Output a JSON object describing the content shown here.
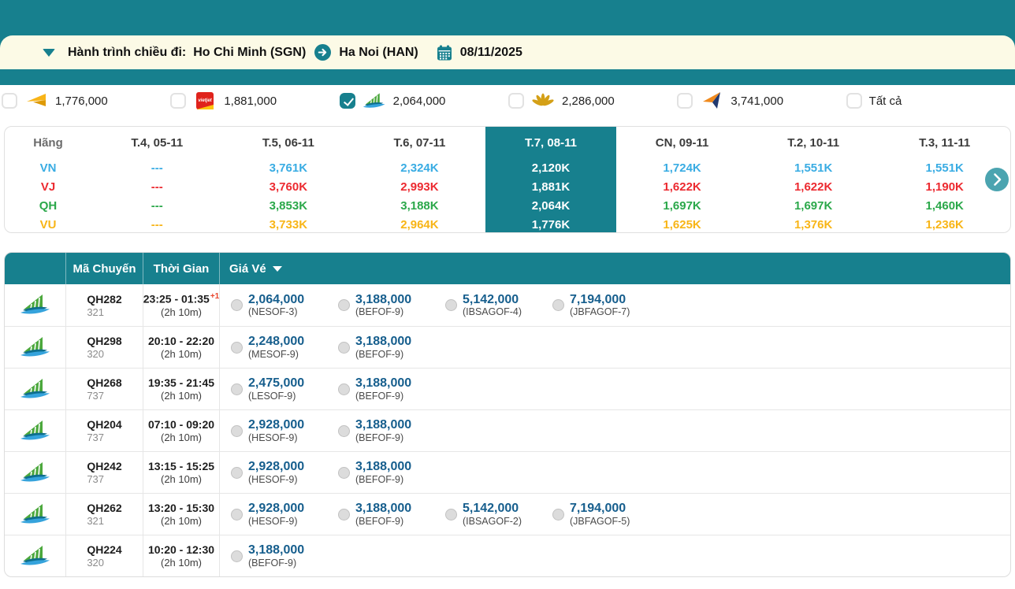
{
  "theme": {
    "teal": "#17808E",
    "teal_light": "#4BA4B0",
    "beige": "#FCFAE6",
    "price_blue": "#165E8D"
  },
  "journey": {
    "label": "Hành trình chiều đi:",
    "origin": "Ho Chi Minh (SGN)",
    "destination": "Ha Noi (HAN)",
    "date": "08/11/2025"
  },
  "filters": {
    "items": [
      {
        "logo": "vietravel-arrow-logo",
        "price": "1,776,000",
        "checked": false
      },
      {
        "logo": "vietjet-logo",
        "price": "1,881,000",
        "checked": false
      },
      {
        "logo": "bamboo-airways-logo",
        "price": "2,064,000",
        "checked": true
      },
      {
        "logo": "vietnam-airlines-lotus-logo",
        "price": "2,286,000",
        "checked": false
      },
      {
        "logo": "paper-plane-logo",
        "price": "3,741,000",
        "checked": false
      },
      {
        "label": "Tất cả",
        "checked": false
      }
    ],
    "vietjet_logo_text": "vietjet"
  },
  "price_matrix": {
    "columns": [
      "Hãng",
      "T.4, 05-11",
      "T.5, 06-11",
      "T.6, 07-11",
      "T.7, 08-11",
      "CN, 09-11",
      "T.2, 10-11",
      "T.3, 11-11"
    ],
    "selected_column_index": 4,
    "rows": [
      {
        "code": "VN",
        "color": "#39ACE3",
        "values": [
          "---",
          "3,761K",
          "2,324K",
          "2,120K",
          "1,724K",
          "1,551K",
          "1,551K"
        ]
      },
      {
        "code": "VJ",
        "color": "#EC2A30",
        "values": [
          "---",
          "3,760K",
          "2,993K",
          "1,881K",
          "1,622K",
          "1,622K",
          "1,190K"
        ]
      },
      {
        "code": "QH",
        "color": "#2BA84A",
        "values": [
          "---",
          "3,853K",
          "3,188K",
          "2,064K",
          "1,697K",
          "1,697K",
          "1,460K"
        ]
      },
      {
        "code": "VU",
        "color": "#F8B517",
        "values": [
          "---",
          "3,733K",
          "2,964K",
          "1,776K",
          "1,625K",
          "1,376K",
          "1,236K"
        ]
      }
    ]
  },
  "flight_table": {
    "headers": {
      "flight_code": "Mã Chuyến",
      "time": "Thời Gian",
      "price": "Giá Vé"
    },
    "rows": [
      {
        "flight": "QH282",
        "aircraft": "321",
        "time": "23:25 - 01:35",
        "plus_day": "+1",
        "duration": "(2h 10m)",
        "fares": [
          {
            "price": "2,064,000",
            "code": "(NESOF-3)"
          },
          {
            "price": "3,188,000",
            "code": "(BEFOF-9)"
          },
          {
            "price": "5,142,000",
            "code": "(IBSAGOF-4)"
          },
          {
            "price": "7,194,000",
            "code": "(JBFAGOF-7)"
          }
        ]
      },
      {
        "flight": "QH298",
        "aircraft": "320",
        "time": "20:10 - 22:20",
        "plus_day": "",
        "duration": "(2h 10m)",
        "fares": [
          {
            "price": "2,248,000",
            "code": "(MESOF-9)"
          },
          {
            "price": "3,188,000",
            "code": "(BEFOF-9)"
          }
        ]
      },
      {
        "flight": "QH268",
        "aircraft": "737",
        "time": "19:35 - 21:45",
        "plus_day": "",
        "duration": "(2h 10m)",
        "fares": [
          {
            "price": "2,475,000",
            "code": "(LESOF-9)"
          },
          {
            "price": "3,188,000",
            "code": "(BEFOF-9)"
          }
        ]
      },
      {
        "flight": "QH204",
        "aircraft": "737",
        "time": "07:10 - 09:20",
        "plus_day": "",
        "duration": "(2h 10m)",
        "fares": [
          {
            "price": "2,928,000",
            "code": "(HESOF-9)"
          },
          {
            "price": "3,188,000",
            "code": "(BEFOF-9)"
          }
        ]
      },
      {
        "flight": "QH242",
        "aircraft": "737",
        "time": "13:15 - 15:25",
        "plus_day": "",
        "duration": "(2h 10m)",
        "fares": [
          {
            "price": "2,928,000",
            "code": "(HESOF-9)"
          },
          {
            "price": "3,188,000",
            "code": "(BEFOF-9)"
          }
        ]
      },
      {
        "flight": "QH262",
        "aircraft": "321",
        "time": "13:20 - 15:30",
        "plus_day": "",
        "duration": "(2h 10m)",
        "fares": [
          {
            "price": "2,928,000",
            "code": "(HESOF-9)"
          },
          {
            "price": "3,188,000",
            "code": "(BEFOF-9)"
          },
          {
            "price": "5,142,000",
            "code": "(IBSAGOF-2)"
          },
          {
            "price": "7,194,000",
            "code": "(JBFAGOF-5)"
          }
        ]
      },
      {
        "flight": "QH224",
        "aircraft": "320",
        "time": "10:20 - 12:30",
        "plus_day": "",
        "duration": "(2h 10m)",
        "fares": [
          {
            "price": "3,188,000",
            "code": "(BEFOF-9)"
          }
        ]
      }
    ]
  }
}
